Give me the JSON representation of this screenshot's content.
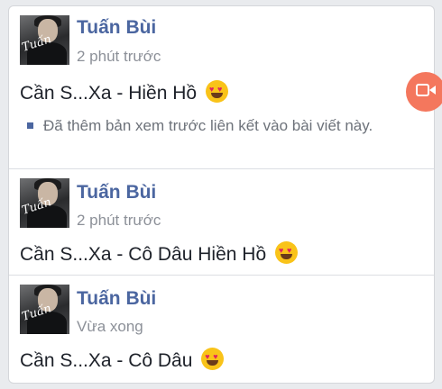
{
  "posts": [
    {
      "author": "Tuấn Bùi",
      "avatar_sig": "Tuấn",
      "time": "2 phút trước",
      "text": "Cần S...Xa - Hiền Hồ",
      "note": "Đã thêm bản xem trước liên kết vào bài viết này."
    },
    {
      "author": "Tuấn Bùi",
      "avatar_sig": "Tuấn",
      "time": "2 phút trước",
      "text": "Cần S...Xa - Cô Dâu Hiền Hồ"
    },
    {
      "author": "Tuấn Bùi",
      "avatar_sig": "Tuấn",
      "time": "Vừa xong",
      "text": "Cần S...Xa - Cô Dâu"
    }
  ],
  "icons": {
    "emoji": "heart-eyes-emoji-icon",
    "live_button": "video-camera-icon"
  },
  "colors": {
    "author": "#4b66a0",
    "time": "#8c9098",
    "live_button": "#f4775d",
    "background": "#e9ebee"
  }
}
